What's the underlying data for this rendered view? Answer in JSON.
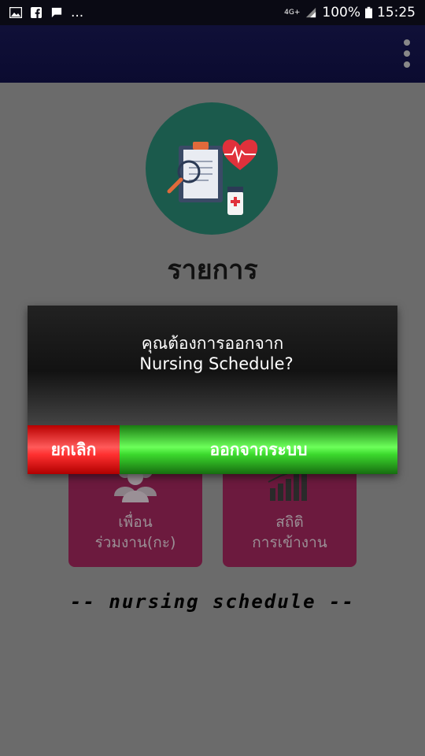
{
  "status_bar": {
    "left_more": "...",
    "network": "4G+",
    "battery": "100%",
    "time": "15:25"
  },
  "page": {
    "title": "รายการ",
    "tiles": [
      {
        "line1": "เพื่อน",
        "line2": "ร่วมงาน(กะ)"
      },
      {
        "line1": "สถิติ",
        "line2": "การเข้างาน"
      }
    ],
    "footer": "-- nursing schedule --"
  },
  "dialog": {
    "message_line1": "คุณต้องการออกจาก",
    "message_line2": "Nursing Schedule?",
    "cancel_label": "ยกเลิก",
    "logout_label": "ออกจากระบบ"
  },
  "colors": {
    "appbar": "#0b0b30",
    "cancel": "#ff3030",
    "logout": "#3bd82d",
    "tile": "#6c1a3e",
    "logo_bg": "#1b5a4c"
  }
}
